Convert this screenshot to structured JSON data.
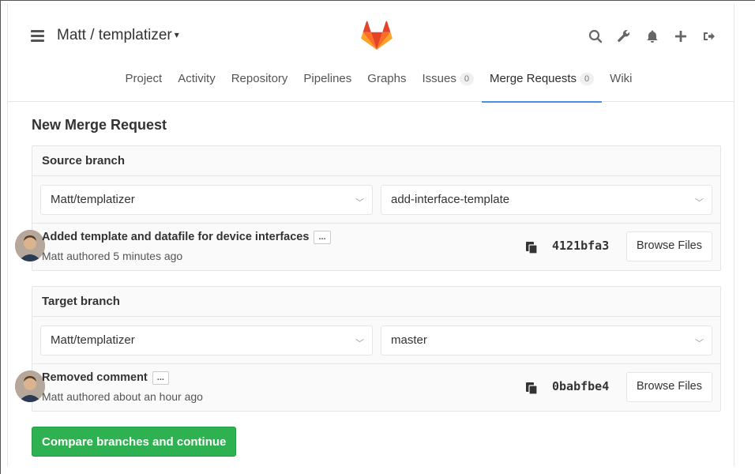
{
  "header": {
    "project_title": "Matt / templatizer",
    "icons": [
      "search-icon",
      "wrench-icon",
      "bell-icon",
      "plus-icon",
      "sign-out-icon"
    ]
  },
  "nav": {
    "tabs": [
      {
        "label": "Project",
        "badge": null,
        "active": false
      },
      {
        "label": "Activity",
        "badge": null,
        "active": false
      },
      {
        "label": "Repository",
        "badge": null,
        "active": false
      },
      {
        "label": "Pipelines",
        "badge": null,
        "active": false
      },
      {
        "label": "Graphs",
        "badge": null,
        "active": false
      },
      {
        "label": "Issues",
        "badge": "0",
        "active": false
      },
      {
        "label": "Merge Requests",
        "badge": "0",
        "active": true
      },
      {
        "label": "Wiki",
        "badge": null,
        "active": false
      }
    ]
  },
  "main": {
    "title": "New Merge Request",
    "source": {
      "heading": "Source branch",
      "project": "Matt/templatizer",
      "branch": "add-interface-template",
      "commit_title": "Added template and datafile for device interfaces",
      "commit_meta": "Matt authored 5 minutes ago",
      "sha": "4121bfa3",
      "browse_label": "Browse Files"
    },
    "target": {
      "heading": "Target branch",
      "project": "Matt/templatizer",
      "branch": "master",
      "commit_title": "Removed comment",
      "commit_meta": "Matt authored about an hour ago",
      "sha": "0babfbe4",
      "browse_label": "Browse Files"
    },
    "ellipsis_label": "...",
    "compare_button": "Compare branches and continue"
  },
  "colors": {
    "accent": "#4a90e2",
    "success": "#2eb150",
    "logo_orange": "#fc6d26"
  }
}
